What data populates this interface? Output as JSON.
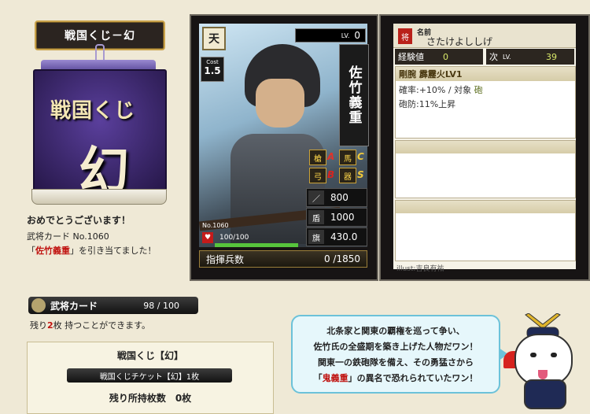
{
  "title_plate": "戦国くじ－幻",
  "lottery_box": {
    "line1": "戦国くじ",
    "line2": "幻"
  },
  "result": {
    "congrats": "おめでとうございます！",
    "card_line": "武将カード No.1060",
    "drew_open": "「",
    "drew_name": "佐竹義重",
    "drew_close": "」を引き当てました！"
  },
  "card": {
    "rank": "天",
    "cost_label": "Cost",
    "cost": "1.5",
    "level_label": "LV.",
    "level": "0",
    "name": "佐竹義重",
    "aptitudes": [
      {
        "icon": "spear-icon",
        "glyph": "槍",
        "grade": "A",
        "color": "#e0332a"
      },
      {
        "icon": "cavalry-icon",
        "glyph": "馬",
        "grade": "C",
        "color": "#f0c83a"
      },
      {
        "icon": "bow-icon",
        "glyph": "弓",
        "grade": "B",
        "color": "#d6231f"
      },
      {
        "icon": "siege-icon",
        "glyph": "器",
        "grade": "S",
        "color": "#f0c83a"
      }
    ],
    "stats": [
      {
        "icon": "attack-icon",
        "glyph": "／",
        "value": "800"
      },
      {
        "icon": "defense-icon",
        "glyph": "盾",
        "value": "1000"
      },
      {
        "icon": "strategy-icon",
        "glyph": "旗",
        "value": "430.0"
      }
    ],
    "number": "No.1060",
    "hp_text": "100/100",
    "hp_fraction": 1.0,
    "troops_label": "指揮兵数",
    "troops_value": "0 /1850"
  },
  "info": {
    "name_icon": "将",
    "name_label": "名前",
    "name_reading": "さたけよししげ",
    "exp_label": "経験値",
    "exp_value": "0",
    "next_label": "次",
    "next_lv": "LV.",
    "next_value": "39",
    "skill_title": "剛腕 霹靂火LV1",
    "skill_desc1_a": "確率:+10% / 対象 ",
    "skill_desc1_b": "砲",
    "skill_desc2": "砲防:11%上昇",
    "illustrator": "illust:吉良有祐"
  },
  "card_count": {
    "label": "武将カード",
    "value": "98 / 100"
  },
  "remain": {
    "pre": "残り",
    "num": "2",
    "post": "枚 持つことができます。"
  },
  "ticket": {
    "title": "戦国くじ【幻】",
    "bar": "戦国くじチケット【幻】1枚",
    "owned": "残り所持枚数　0枚"
  },
  "bubble": {
    "line1": "北条家と関東の覇権を巡って争い、",
    "line2": "佐竹氏の全盛期を築き上げた人物だワン！",
    "line3": "関東一の鉄砲隊を備え、その勇猛さから",
    "line4_a": "「",
    "line4_hl": "鬼義重",
    "line4_b": "」の異名で恐れられていたワン！"
  },
  "colors": {
    "highlight": "#c0120f",
    "bubble_border": "#6cc2d9",
    "gold": "#c9a24a"
  }
}
